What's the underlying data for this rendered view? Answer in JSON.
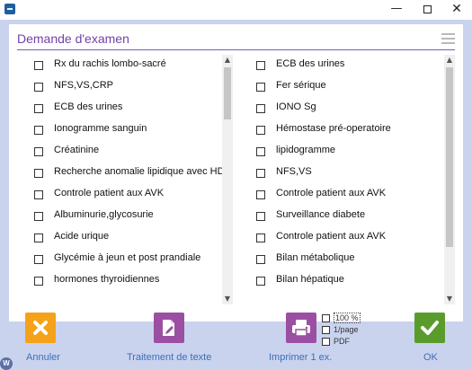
{
  "window": {
    "icon": "app-icon",
    "controls": {
      "minimize": "—",
      "close": "✕"
    }
  },
  "panel": {
    "title": "Demande d'examen",
    "menu_icon": "hamburger-icon"
  },
  "left_list": [
    {
      "label": "Rx du rachis lombo-sacré",
      "checked": false
    },
    {
      "label": "NFS,VS,CRP",
      "checked": false
    },
    {
      "label": "ECB des urines",
      "checked": false
    },
    {
      "label": " Ionogramme sanguin",
      "checked": false
    },
    {
      "label": " Créatinine",
      "checked": false
    },
    {
      "label": " Recherche  anomalie lipidique avec  HDL",
      "checked": false
    },
    {
      "label": "Controle patient aux AVK",
      "checked": false
    },
    {
      "label": " Albuminurie,glycosurie",
      "checked": false
    },
    {
      "label": "Acide urique",
      "checked": false
    },
    {
      "label": "Glycémie à jeun et post prandiale",
      "checked": false
    },
    {
      "label": "hormones thyroidiennes",
      "checked": false
    }
  ],
  "right_list": [
    {
      "label": "ECB des urines",
      "checked": false
    },
    {
      "label": "Fer sérique",
      "checked": false
    },
    {
      "label": "IONO Sg",
      "checked": false
    },
    {
      "label": "Hémostase pré-operatoire",
      "checked": false
    },
    {
      "label": "lipidogramme",
      "checked": false
    },
    {
      "label": "NFS,VS",
      "checked": false
    },
    {
      "label": "Controle patient aux AVK",
      "checked": false
    },
    {
      "label": "Surveillance diabete",
      "checked": false
    },
    {
      "label": "Controle patient aux AVK",
      "checked": false
    },
    {
      "label": "Bilan métabolique",
      "checked": false
    },
    {
      "label": "Bilan hépatique",
      "checked": false
    }
  ],
  "scroll_arrows": {
    "up": "▲",
    "down": "▼"
  },
  "actions": {
    "cancel": {
      "label": "Annuler",
      "icon": "close-icon",
      "color": "#f5a21b"
    },
    "text": {
      "label": "Traitement de texte",
      "icon": "edit-document-icon",
      "color": "#9b4fa3"
    },
    "print": {
      "label": "Imprimer 1 ex.",
      "icon": "printer-icon",
      "color": "#9b4fa3"
    },
    "ok": {
      "label": "OK",
      "icon": "checkmark-icon",
      "color": "#5a9c2c"
    }
  },
  "print_options": [
    {
      "label": "100 %",
      "checked": false
    },
    {
      "label": "1/page",
      "checked": false
    },
    {
      "label": "PDF",
      "checked": false
    }
  ],
  "corner_badge": "W",
  "colors": {
    "accent": "#6f43a8",
    "background": "#c9d3ee",
    "link": "#3f6eb5"
  }
}
